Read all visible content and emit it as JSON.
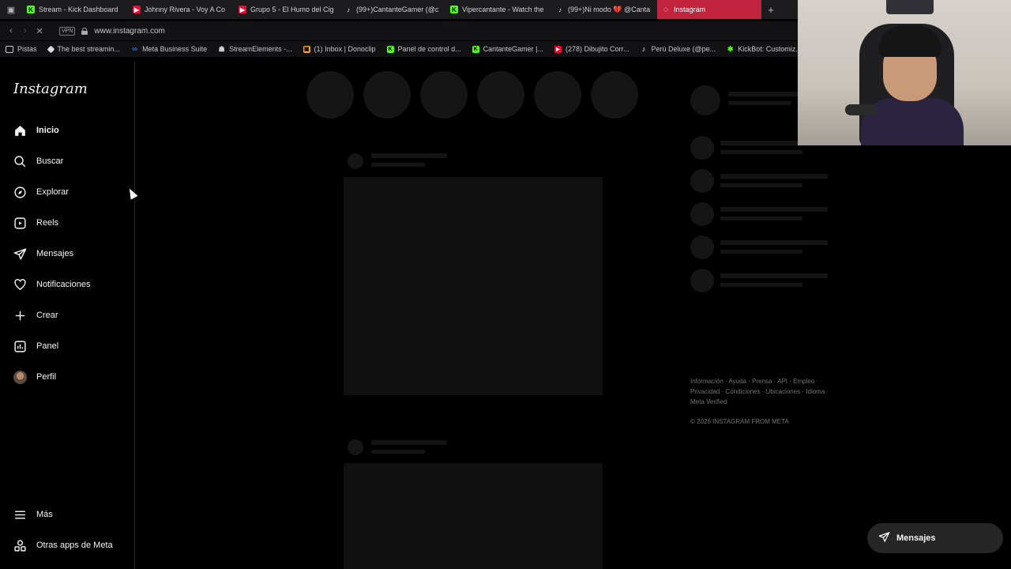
{
  "browser": {
    "tabs": [
      {
        "label": "Stream - Kick Dashboard",
        "icon": "kick-icon",
        "color": "#53fc18"
      },
      {
        "label": "Johnny Rivera - Voy A Co",
        "icon": "youtube-icon",
        "color": "#ff0033"
      },
      {
        "label": "Grupo 5 - El Humo del Cig",
        "icon": "youtube-icon",
        "color": "#ff0033"
      },
      {
        "label": "(99+)CantanteGamer (@c",
        "icon": "tiktok-icon",
        "color": "#ffffff"
      },
      {
        "label": "Vipercantante - Watch the",
        "icon": "kick-icon",
        "color": "#53fc18"
      },
      {
        "label": "(99+)Ni modo 💔 @Canta",
        "icon": "tiktok-icon",
        "color": "#ffffff"
      },
      {
        "label": "Instagram",
        "icon": "loading-icon",
        "color": "#ffffff",
        "active": true
      }
    ],
    "new_tab": "+",
    "vpn_label": "VPN",
    "url": "www.instagram.com",
    "bookmarks": [
      {
        "label": "Pistas",
        "icon": "folder-icon",
        "color": "#c9c9c9"
      },
      {
        "label": "The best streamin...",
        "icon": "streamlabs-icon",
        "color": "#dddddd"
      },
      {
        "label": "Meta Business Suite",
        "icon": "meta-icon",
        "color": "#1877f2"
      },
      {
        "label": "StreamElements -...",
        "icon": "streamelements-icon",
        "color": "#cfcfcf"
      },
      {
        "label": "(1) Inbox | Donoclip",
        "icon": "donoclip-icon",
        "color": "#f5a623"
      },
      {
        "label": "Panel de control d...",
        "icon": "kick-icon",
        "color": "#53fc18"
      },
      {
        "label": "CantanteGamer |...",
        "icon": "kick-icon",
        "color": "#53fc18"
      },
      {
        "label": "(278) Dibujito Corr...",
        "icon": "youtube-icon",
        "color": "#ff0033"
      },
      {
        "label": "Perú Deluxe (@pe...",
        "icon": "tiktok-icon",
        "color": "#ffffff"
      },
      {
        "label": "KickBot: Customiz...",
        "icon": "kickbot-icon",
        "color": "#53fc18"
      }
    ]
  },
  "instagram": {
    "logo": "Instagram",
    "nav": [
      {
        "label": "Inicio",
        "icon": "home-icon",
        "active": true
      },
      {
        "label": "Buscar",
        "icon": "search-icon"
      },
      {
        "label": "Explorar",
        "icon": "compass-icon"
      },
      {
        "label": "Reels",
        "icon": "reels-icon"
      },
      {
        "label": "Mensajes",
        "icon": "messages-icon"
      },
      {
        "label": "Notificaciones",
        "icon": "heart-icon"
      },
      {
        "label": "Crear",
        "icon": "plus-icon"
      },
      {
        "label": "Panel",
        "icon": "chart-icon"
      },
      {
        "label": "Perfil",
        "icon": "avatar"
      }
    ],
    "more": {
      "label": "Más",
      "icon": "menu-icon"
    },
    "other_apps": {
      "label": "Otras apps de Meta",
      "icon": "meta-apps-icon"
    },
    "footer": {
      "links_line1": "Información · Ayuda · Prensa · API · Empleo ·",
      "links_line2": "Privacidad · Condiciones · Ubicaciones · Idioma ·",
      "links_line3": "Meta Verified",
      "copyright": "© 2026 INSTAGRAM FROM META"
    },
    "messages_pill": {
      "label": "Mensajes",
      "icon": "messages-icon"
    }
  },
  "colors": {
    "active_tab": "#c2233d",
    "background": "#000000",
    "skeleton": "#141414"
  }
}
